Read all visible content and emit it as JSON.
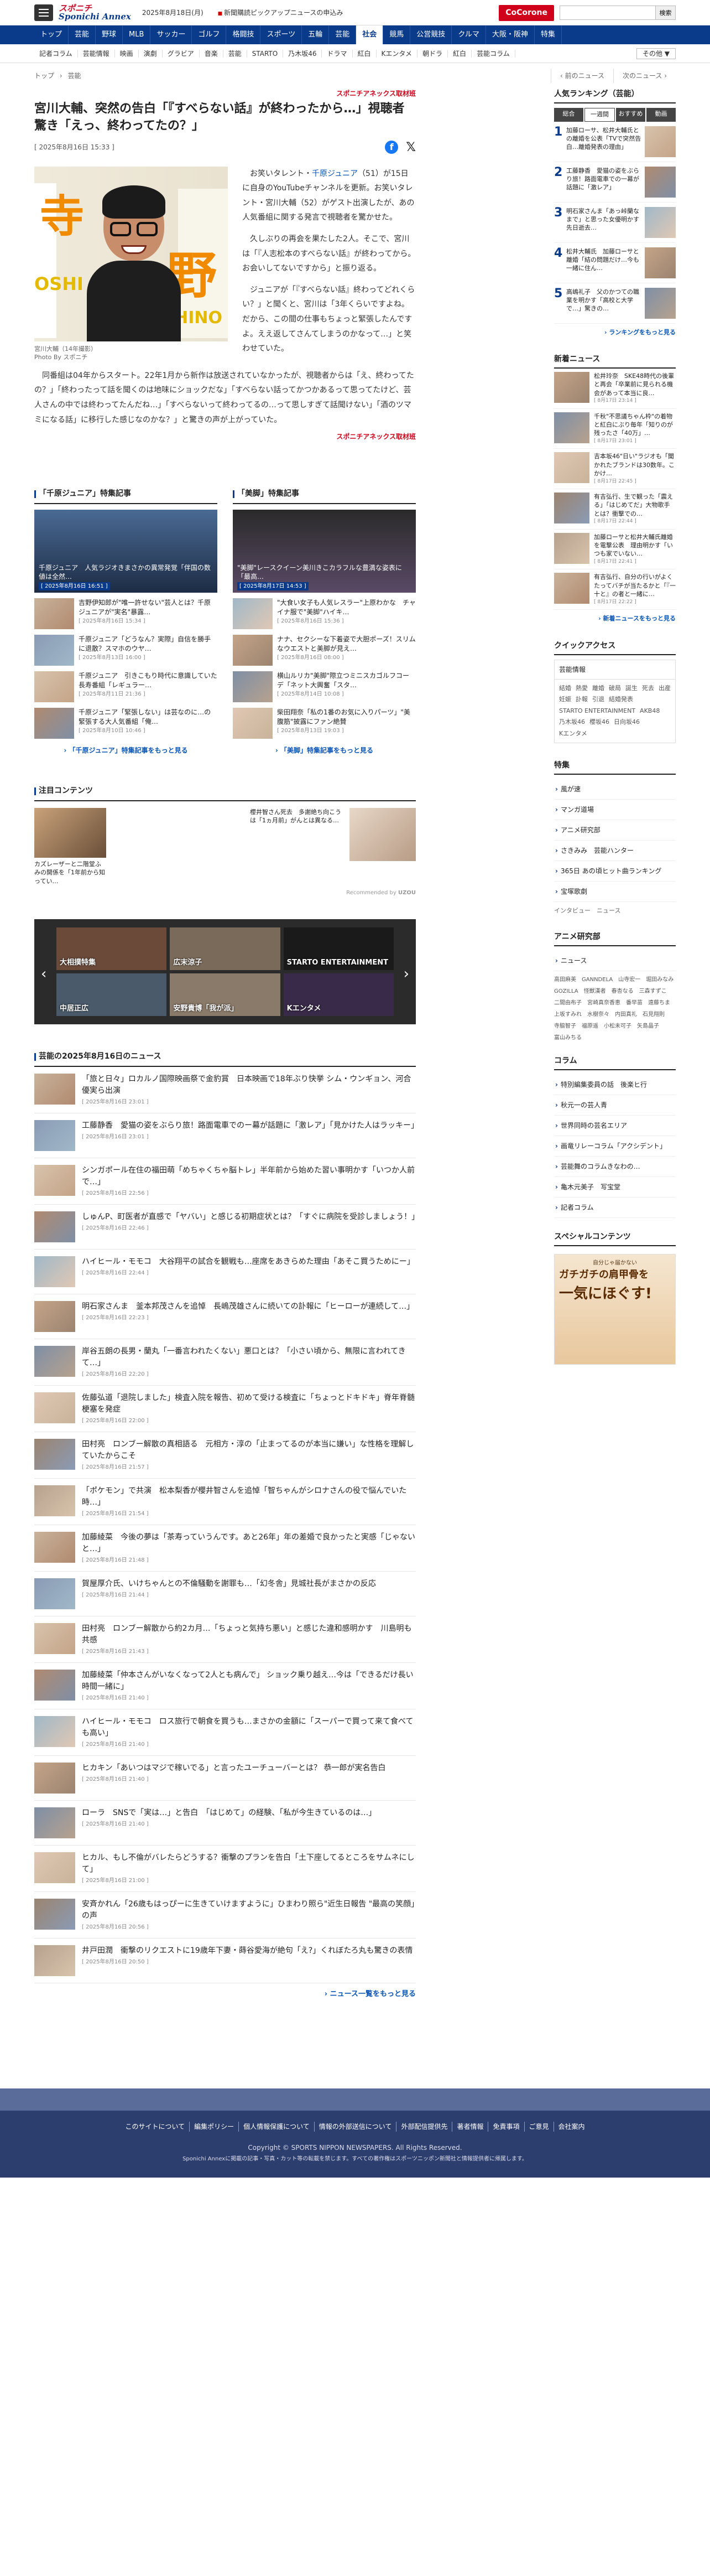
{
  "header": {
    "logo_line1": "スポニチ",
    "logo_line2": "Sponichi Annex",
    "date": "2025年8月18日(月)",
    "newsletter": "新聞購読ピックアップニュースの申込み",
    "cocorone": "CoCorone",
    "search_button": "検索"
  },
  "nav": [
    "トップ",
    "芸能",
    "野球",
    "MLB",
    "サッカー",
    "ゴルフ",
    "格闘技",
    "スポーツ",
    "五輪",
    "芸能",
    "社会",
    "競馬",
    "公営競技",
    "クルマ",
    "大阪・阪神",
    "特集"
  ],
  "subnav": [
    "記者コラム",
    "芸能情報",
    "映画",
    "演劇",
    "グラビア",
    "音楽",
    "芸能",
    "STARTO",
    "乃木坂46",
    "ドラマ",
    "紅白",
    "Kエンタメ",
    "朝ドラ",
    "紅白",
    "芸能コラム"
  ],
  "subnav_more": "その他 ▼",
  "breadcrumb": [
    "トップ",
    "›",
    "芸能"
  ],
  "pager": {
    "prev": "‹ 前のニュース",
    "next": "次のニュース ›"
  },
  "article": {
    "source": "スポニチアネックス取材班",
    "title": "宮川大輔、突然の告白「『すべらない話』が終わったから…」視聴者驚き「えっ、終わってたの？」",
    "date": "[ 2025年8月16日 15:33 ]",
    "caption": "宮川大輔（14年撮影）",
    "photo_by": "Photo By スポニチ",
    "p1_pre": "お笑いタレント・",
    "p1_link": "千原ジュニア",
    "p1_post": "（51）が15日に自身のYouTubeチャンネルを更新。お笑いタレント・宮川大輔（52）がゲスト出演したが、あの人気番組に関する発言で視聴者を驚かせた。",
    "p2": "久しぶりの再会を果たした2人。そこで、宮川は「『人志松本のすべらない話』が終わってから。お会いしてないですから」と振り返る。",
    "p3": "ジュニアが「『すべらない話』終わってどれくらい？」と聞くと、宮川は「3年くらいですよね。だから、この間の仕事もちょっと緊張したんですよ。ええ返してさんてしまうのかなって…」と笑わせていた。",
    "p4": "同番組は04年からスタート。22年1月から新作は放送されていなかったが、視聴者からは「え、終わってたの？」「終わったって話を聞くのは地味にショックだな」「すべらない話ってかつかあるって思ってたけど、芸人さんの中では終わってたんだね…」「すべらないって終わってるの…って思しすぎて話聞けない」「酒のツマミになる話」に移行した感じなのかな？」と驚きの声が上がっていた。",
    "bottom_source": "スポニチアネックス取材班"
  },
  "features": [
    {
      "title": "「千原ジュニア」特集記事",
      "main_caption": "千原ジュニア　人気ラジオきまさかの異常発覚「伴国の数値は全然…",
      "main_date": "[ 2025年8月16日 16:51 ]",
      "items": [
        {
          "t": "吉野伊知郎が\"唯一許せない\"芸人とは？千原ジュニアが\"実名\"暴露…",
          "d": "[ 2025年8月16日 15:34 ]"
        },
        {
          "t": "千原ジュニア「どうなん？実際」自信を勝手に退散？スマホのウヤ…",
          "d": "[ 2025年8月13日 16:00 ]"
        },
        {
          "t": "千原ジュニア　引きこもり時代に意識していた長寿番組「レギュラー…",
          "d": "[ 2025年8月11日 21:36 ]"
        },
        {
          "t": "千原ジュニア「緊張しない」は芸なのに…の緊張する大人気番組「俺…",
          "d": "[ 2025年8月10日 10:46 ]"
        }
      ],
      "more": "「千原ジュニア」特集記事をもっと見る"
    },
    {
      "title": "「美脚」特集記事",
      "main_caption": "\"美脚\"レースクイーン美川きこカラフルな豊満な姿表に「最高…",
      "main_date": "[ 2025年8月17日 14:53 ]",
      "items": [
        {
          "t": "\"大食い女子も人気レスラー\"上原わかな　チャイナ服で\"美脚\"ハイキ…",
          "d": "[ 2025年8月16日 15:36 ]"
        },
        {
          "t": "ナナ、セクシーな下着姿で大胆ポーズ！スリムなウエストと美脚が見え…",
          "d": "[ 2025年8月16日 08:00 ]"
        },
        {
          "t": "横山ルリカ\"美脚\"際立つミニスカゴルフコーデ「ネット大興奮「スタ…",
          "d": "[ 2025年8月14日 10:08 ]"
        },
        {
          "t": "柴田翔奈「私の1番のお気に入りパーツ」\"美腹筋\"披露にファン絶賛",
          "d": "[ 2025年8月13日 19:03 ]"
        }
      ],
      "more": "「美脚」特集記事をもっと見る"
    }
  ],
  "attention": {
    "title": "注目コンテンツ",
    "card1": "カズレーザーと二階堂ふみの開係を「1年前から知ってい…",
    "card2": "櫻井智さん死去　多謝絶ち向こうは「1ヵ月前」がんとは異なる…",
    "powered": "Recommended by",
    "uzou": "UZOU"
  },
  "carousel": [
    "大相撲特集",
    "広末涼子",
    "STARTO ENTERTAINMENT",
    "中居正広",
    "安野貴博「我が派」",
    "Kエンタメ"
  ],
  "news_list_title": "芸能の2025年8月16日のニュース",
  "news": [
    {
      "t": "「旅と日々」ロカルノ国際映画祭で金豹賞　日本映画で18年ぶり快挙 シム・ウンギョン、河合優実ら出演",
      "d": "[ 2025年8月16日 23:01 ]"
    },
    {
      "t": "工藤静香　愛猫の姿をぶらり旅！路面電車でのー幕が話題に「激レア」「見かけた人はラッキー」",
      "d": "[ 2025年8月16日 23:01 ]"
    },
    {
      "t": "シンガポール在住の福田萌「めちゃくちゃ脳トレ」半年前から始めた習い事明かす「いつか人前で…」",
      "d": "[ 2025年8月16日 22:56 ]"
    },
    {
      "t": "しゅんP、町医者が直感で「ヤバい」と感じる初期症状とは？「すぐに病院を受診しましょう！」",
      "d": "[ 2025年8月16日 22:46 ]"
    },
    {
      "t": "ハイヒール・モモコ　大谷翔平の試合を観戦も…座席をあきらめた理由「あそこ買うためにー」",
      "d": "[ 2025年8月16日 22:44 ]"
    },
    {
      "t": "明石家さんま　釜本邦茂さんを追悼　長嶋茂雄さんに続いての訃報に「ヒーローが連続して…」",
      "d": "[ 2025年8月16日 22:23 ]"
    },
    {
      "t": "岸谷五朗の長男・蘭丸「一番言われたくない」悪口とは？「小さい頃から、無限に言われてきて…」",
      "d": "[ 2025年8月16日 22:20 ]"
    },
    {
      "t": "佐藤弘道「退院しました」検査入院を報告、初めて受ける検査に「ちょっとドキドキ」脊年脊髄梗塞を発症",
      "d": "[ 2025年8月16日 22:00 ]"
    },
    {
      "t": "田村亮　ロンブー解散の真相語る　元相方・淳の「止まってるのが本当に嫌い」な性格を理解していたからこそ",
      "d": "[ 2025年8月16日 21:57 ]"
    },
    {
      "t": "「ポケモン」で共演　松本梨香が櫻井智さんを追悼「智ちゃんがシロナさんの役で悩んでいた時…」",
      "d": "[ 2025年8月16日 21:54 ]"
    },
    {
      "t": "加藤綾菜　今後の夢は「茶寿っていうんです。あと26年」年の差婚で良かったと実感「じゃないと…」",
      "d": "[ 2025年8月16日 21:48 ]"
    },
    {
      "t": "賀屋厚介氏、いけちゃんとの不倫騒動を謝罪も…「幻冬舎」見城社長がまさかの反応",
      "d": "[ 2025年8月16日 21:44 ]"
    },
    {
      "t": "田村亮　ロンブー解散から約2カ月…「ちょっと気持ち悪い」と感じた違和感明かす　川島明も共感",
      "d": "[ 2025年8月16日 21:43 ]"
    },
    {
      "t": "加藤綾菜「仲本さんがいなくなって2人とも病んで」 ショック乗り越え…今は「できるだけ長い時間一緒に」",
      "d": "[ 2025年8月16日 21:40 ]"
    },
    {
      "t": "ハイヒール・モモコ　ロス旅行で朝食を買うも…まさかの金額に「スーパーで買って来て食べても高い」",
      "d": "[ 2025年8月16日 21:40 ]"
    },
    {
      "t": "ヒカキン「あいつはマジで稼いでる」と言ったユーチューバーとは？ 恭一郎が実名告白",
      "d": "[ 2025年8月16日 21:40 ]"
    },
    {
      "t": "ローラ　SNSで「実は…」と告白　「はじめて」の経験、「私が今生きているのは…」",
      "d": "[ 2025年8月16日 21:40 ]"
    },
    {
      "t": "ヒカル、もし不倫がバレたらどうする？衝撃のプランを告白「土下座してるところをサムネにして」",
      "d": "[ 2025年8月16日 21:00 ]"
    },
    {
      "t": "安斉かれん「26歳もはっぴーに生きていけますように」ひまわり照ら\"近生日報告 \"最高の笑顔」の声",
      "d": "[ 2025年8月16日 20:56 ]"
    },
    {
      "t": "井戸田潤　衝撃のリクエストに19歳年下妻・蒔谷愛海が絶句「え?」くれぼたろ丸も驚きの表情",
      "d": "[ 2025年8月16日 20:50 ]"
    }
  ],
  "news_more": "ニュース一覧をもっと見る",
  "sidebar": {
    "ranking_title": "人気ランキング（芸能）",
    "rank_tabs": [
      "総合",
      "一週間",
      "おすすめ",
      "動画"
    ],
    "rankings": [
      {
        "n": "1",
        "t": "加藤ローサ、松井大輔氏との離婚を公表「TVで突然告白…離婚発表の理由」"
      },
      {
        "n": "2",
        "t": "工藤静香　愛猫の姿をぶらり旅！路面電車での一幕が話題に「激レア」"
      },
      {
        "n": "3",
        "t": "明石家さんま「あっ峠蘭なまで」と思った女優明かす　先日逝去…"
      },
      {
        "n": "4",
        "t": "松井大輔氏　加藤ローサと離婚「結の問題だけ…今も一緒に住ん…"
      },
      {
        "n": "5",
        "t": "高嶋礼子　父のかつての職業を明かす「高校と大学で…」驚きの…"
      }
    ],
    "ranking_more": "ランキングをもっと見る",
    "news_title": "新着ニュース",
    "new_news": [
      {
        "t": "松井玲奈　SKE48時代の後輩と再会「卒業前に見られる機会があって本当に良…",
        "d": "[ 8月17日 23:14 ]"
      },
      {
        "t": "千秋\"不思議ちゃん枠\"の着物と紅白にぶり毎年「知りのが残ったさ「40万」…",
        "d": "[ 8月17日 23:01 ]"
      },
      {
        "t": "吉本坂46\"日い\"ラジオも「聞かれたブランドは30数年。こかけ…",
        "d": "[ 8月17日 22:45 ]"
      },
      {
        "t": "有吉弘行、生で観った「震える」「はじめてだ」大物歌手とは？衝撃での…",
        "d": "[ 8月17日 22:44 ]"
      },
      {
        "t": "加藤ローサと松井大輔氏離婚を電撃公表　理由明かす「いつも家でいない…",
        "d": "[ 8月17日 22:41 ]"
      },
      {
        "t": "有吉弘行、自分の行いがよくたってバチが当たるかと「『一十と』の者と一緒に…",
        "d": "[ 8月17日 22:22 ]"
      }
    ],
    "new_news_more": "新着ニュースをもっと見る",
    "quick_title": "クイックアクセス",
    "quick_head": "芸能情報",
    "quick_tags": [
      "結婚",
      "熱愛",
      "離婚",
      "破局",
      "誕生",
      "死去",
      "出産",
      "妊娠",
      "訃報",
      "引退",
      "結婚発表",
      "STARTO ENTERTAINMENT",
      "AKB48",
      "乃木坂46",
      "櫻坂46",
      "日向坂46",
      "Kエンタメ"
    ],
    "special_title": "特集",
    "special": [
      "風が速",
      "マンガ道場",
      "アニメ研究部",
      "さきみみ　芸能ハンター",
      "365日 あの頃ヒット曲ランキング",
      "宝塚歌劇"
    ],
    "interview": "インタビュー　ニュース",
    "anime_title": "アニメ研究部",
    "anime_sub": "ニュース",
    "anime_tags": [
      "高田麻美",
      "GANNDELA",
      "山寺宏一",
      "堀田みなみ",
      "GOZILLA",
      "怪獣漢者",
      "春杏なる",
      "三森すずこ",
      "二間由布子",
      "宮崎真奈香恵",
      "番早苗",
      "遠藤ちま",
      "上坂すみれ",
      "水樹奈々",
      "内田真礼",
      "石見翔則",
      "寺脇智子",
      "福原遥",
      "小松未可子",
      "矢島晶子",
      "富山みちる"
    ],
    "column_title": "コラム",
    "columns": [
      "特別編集委員の話　後楽ヒ行",
      "秋元一の芸人青",
      "世界同時の芸名エリア",
      "画竜リレーコラム「アクシデント」",
      "芸能舞のコラムきなわの…",
      "亀木元美子　写宝堂",
      "記者コラム"
    ],
    "special_site_title": "スペシャルコンテンツ",
    "ad_line1": "自分じゃ届かない",
    "ad_line2": "ガチガチの肩甲骨を",
    "ad_line3": "一気にほぐす!"
  },
  "footer": {
    "links": [
      "このサイトについて",
      "編集ポリシー",
      "個人情報保護について",
      "情報の外部送信について",
      "外部配信提供先",
      "著者情報",
      "免責事項",
      "ご意見",
      "会社案内"
    ],
    "copy": "Copyright © SPORTS NIPPON NEWSPAPERS. All Rights Reserved.",
    "notice": "Sponichi Annexに掲載の記事・写真・カット等の転載を禁じます。すべての著作権はスポーツニッポン新聞社と情報提供者に帰属します。"
  }
}
